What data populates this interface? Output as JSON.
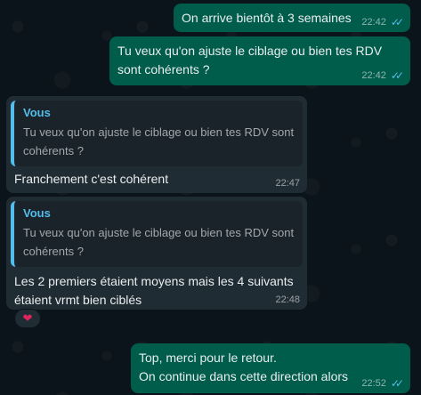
{
  "messages": [
    {
      "text": "On arrive bientôt à 3 semaines",
      "time": "22:42",
      "direction": "out",
      "status": "read"
    },
    {
      "text": "Tu veux qu'on ajuste le ciblage ou bien tes RDV sont cohérents ?",
      "time": "22:42",
      "direction": "out",
      "status": "read"
    },
    {
      "quote_author": "Vous",
      "quote_text": "Tu veux qu'on ajuste le ciblage ou bien tes RDV sont cohérents ?",
      "text": "Franchement c'est cohérent",
      "time": "22:47",
      "direction": "in"
    },
    {
      "quote_author": "Vous",
      "quote_text": "Tu veux qu'on ajuste le ciblage ou bien tes RDV sont cohérents ?",
      "text": "Les 2 premiers étaient moyens mais les 4 suivants étaient vrmt bien ciblés",
      "time": "22:48",
      "direction": "in",
      "reaction": "❤"
    },
    {
      "text": "Top, merci pour le retour.\nOn continue dans cette direction alors",
      "time": "22:52",
      "direction": "out",
      "status": "read"
    }
  ],
  "colors": {
    "background": "#0b141a",
    "outgoing_bubble": "#005c4b",
    "incoming_bubble": "#202c33",
    "accent": "#53bdeb",
    "read_ticks": "#53bdeb",
    "reaction_heart": "#e0245e"
  },
  "icons": {
    "read_status": "double-check-icon",
    "reaction": "heart-icon"
  }
}
